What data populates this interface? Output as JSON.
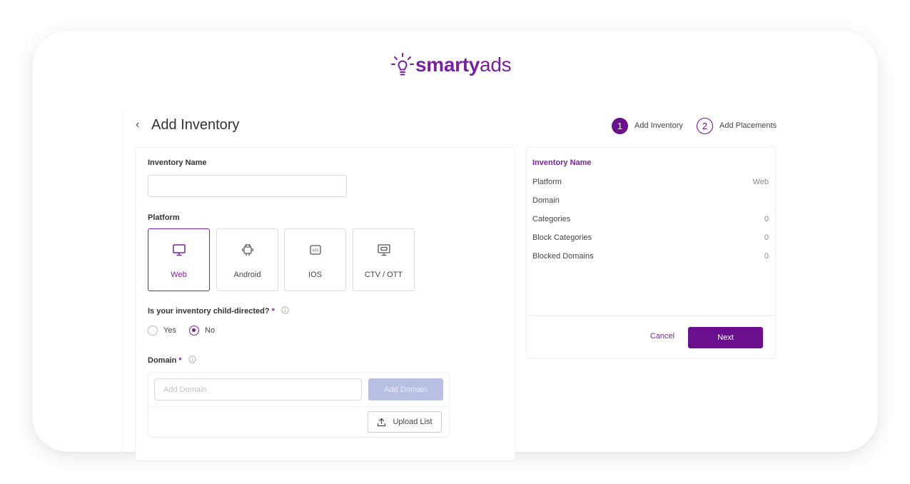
{
  "logo": {
    "name_bold": "smarty",
    "name_light": "ads"
  },
  "header": {
    "back_icon": "‹",
    "title": "Add Inventory"
  },
  "stepper": [
    {
      "number": "1",
      "label": "Add Inventory"
    },
    {
      "number": "2",
      "label": "Add Placements"
    }
  ],
  "form": {
    "inventory_name": {
      "label": "Inventory Name",
      "value": "",
      "placeholder": ""
    },
    "platform": {
      "label": "Platform",
      "selected": "Web",
      "options": [
        {
          "label": "Web",
          "icon": "monitor-icon"
        },
        {
          "label": "Android",
          "icon": "android-icon"
        },
        {
          "label": "IOS",
          "icon": "ios-icon"
        },
        {
          "label": "CTV / OTT",
          "icon": "ctv-icon"
        }
      ]
    },
    "child_directed": {
      "label": "Is your inventory child-directed?",
      "required_mark": "*",
      "options": [
        "Yes",
        "No"
      ],
      "selected": "No"
    },
    "domain": {
      "label": "Domain",
      "required_mark": "*",
      "placeholder": "Add Domain",
      "add_button": "Add Domain",
      "upload_button": "Upload List"
    }
  },
  "summary": {
    "title": "Inventory Name",
    "rows": [
      {
        "label": "Platform",
        "value": "Web"
      },
      {
        "label": "Domain",
        "value": ""
      },
      {
        "label": "Categories",
        "value": "0"
      },
      {
        "label": "Block Categories",
        "value": "0"
      },
      {
        "label": "Blocked Domains",
        "value": "0"
      }
    ],
    "cancel_label": "Cancel",
    "next_label": "Next"
  },
  "colors": {
    "brand": "#6a0f8e",
    "accent": "#7a1fa2",
    "disabled_button": "#b8bfe3"
  }
}
